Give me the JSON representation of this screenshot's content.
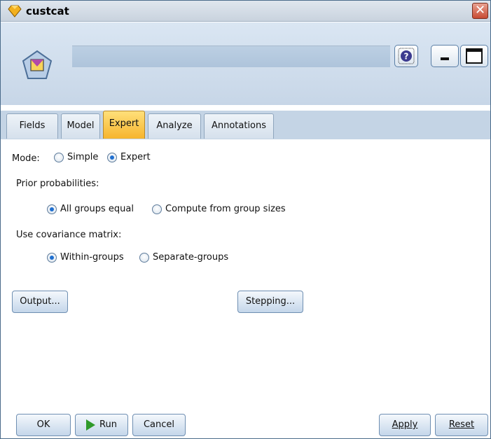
{
  "window": {
    "title": "custcat"
  },
  "header": {
    "name_value": "",
    "help_icon": "question-icon",
    "minimize_icon": "minimize-icon",
    "maximize_icon": "maximize-icon"
  },
  "tabs": [
    {
      "label": "Fields",
      "active": false
    },
    {
      "label": "Model",
      "active": false
    },
    {
      "label": "Expert",
      "active": true
    },
    {
      "label": "Analyze",
      "active": false
    },
    {
      "label": "Annotations",
      "active": false
    }
  ],
  "mode": {
    "label": "Mode:",
    "options": [
      {
        "label": "Simple",
        "selected": false
      },
      {
        "label": "Expert",
        "selected": true
      }
    ]
  },
  "prior": {
    "label": "Prior probabilities:",
    "options": [
      {
        "label": "All groups equal",
        "selected": true
      },
      {
        "label": "Compute from group sizes",
        "selected": false
      }
    ]
  },
  "covariance": {
    "label": "Use covariance matrix:",
    "options": [
      {
        "label": "Within-groups",
        "selected": true
      },
      {
        "label": "Separate-groups",
        "selected": false
      }
    ]
  },
  "buttons": {
    "output": "Output...",
    "stepping": "Stepping...",
    "ok": "OK",
    "run": "Run",
    "cancel": "Cancel",
    "apply": "Apply",
    "reset": "Reset"
  },
  "colors": {
    "active_tab": "#f6b42d",
    "header_bg": "#c7d6e7",
    "run_icon": "#2f9a2a"
  }
}
